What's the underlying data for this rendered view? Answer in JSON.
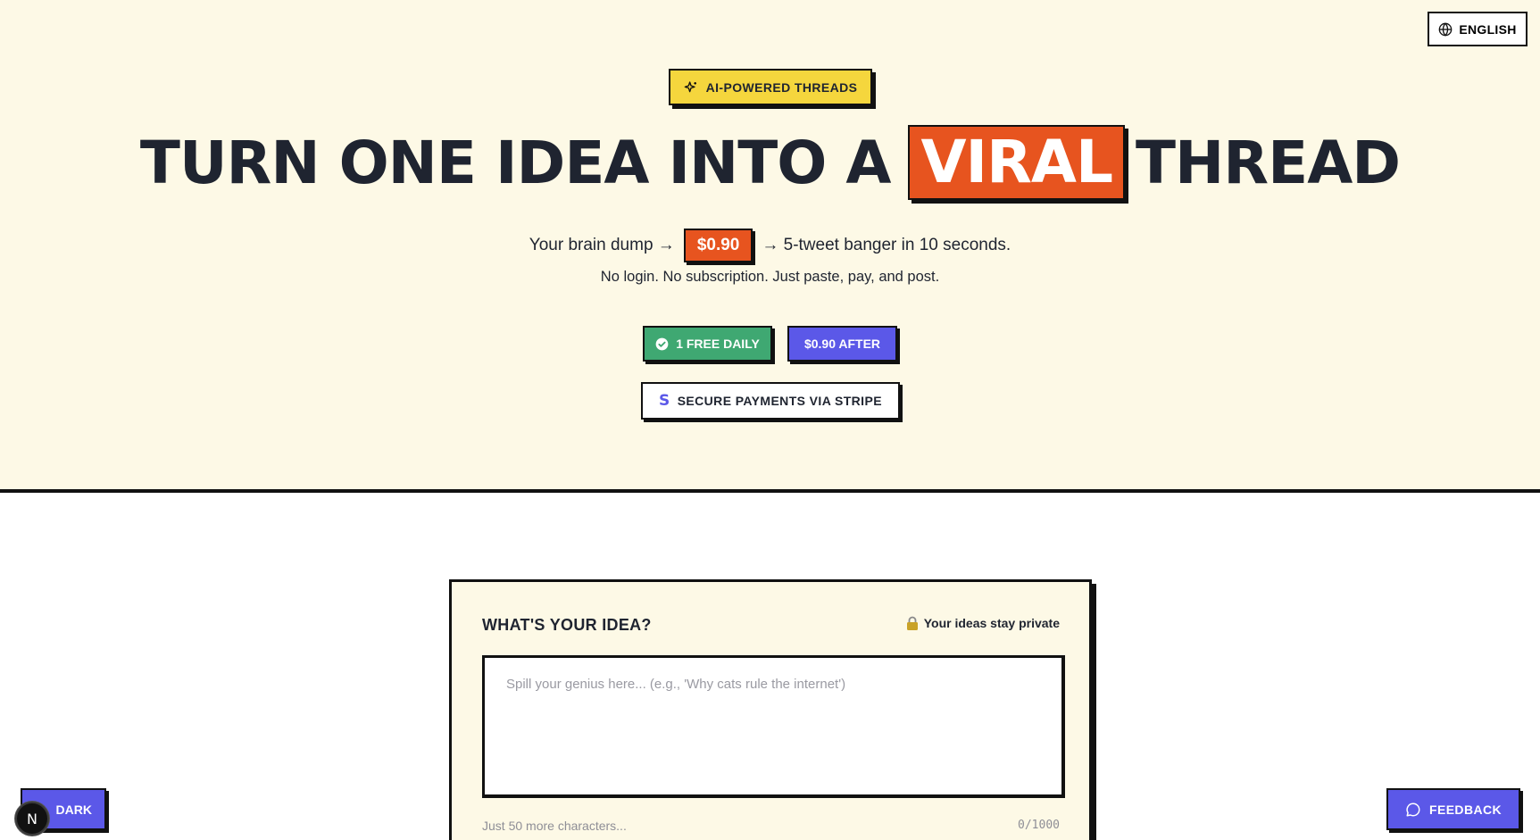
{
  "header": {
    "language_label": "ENGLISH",
    "language_icon": "globe-icon"
  },
  "hero": {
    "badge_label": "AI-POWERED THREADS",
    "badge_icon": "sparkles-icon",
    "headline_before": "TURN ONE IDEA INTO A",
    "headline_highlight": "VIRAL",
    "headline_after": "THREAD",
    "tagline_start": "Your brain dump →",
    "tagline_price": "$0.90",
    "tagline_end": "→ 5-tweet banger in 10 seconds.",
    "subline": "No login. No subscription. Just paste, pay, and post.",
    "free_label": "1 FREE DAILY",
    "after_label": "$0.90 AFTER",
    "stripe_symbol": "S",
    "stripe_label": "SECURE PAYMENTS VIA STRIPE"
  },
  "idea_card": {
    "title": "WHAT'S YOUR IDEA?",
    "privacy_label": "Your ideas stay private",
    "input_placeholder": "Spill your genius here... (e.g., 'Why cats rule the internet')",
    "input_value": "",
    "hint": "Just 50 more characters...",
    "counter": "0/1000"
  },
  "footer_controls": {
    "theme_label": "DARK",
    "dev_badge": "N",
    "feedback_label": "FEEDBACK",
    "feedback_icon": "chat-bubble-icon"
  },
  "colors": {
    "hero_background": "#fdf9e6",
    "accent_orange": "#e7541f",
    "accent_yellow": "#f5d63d",
    "accent_green": "#3fa872",
    "accent_purple": "#5b58e8",
    "ink": "#1f2430"
  }
}
